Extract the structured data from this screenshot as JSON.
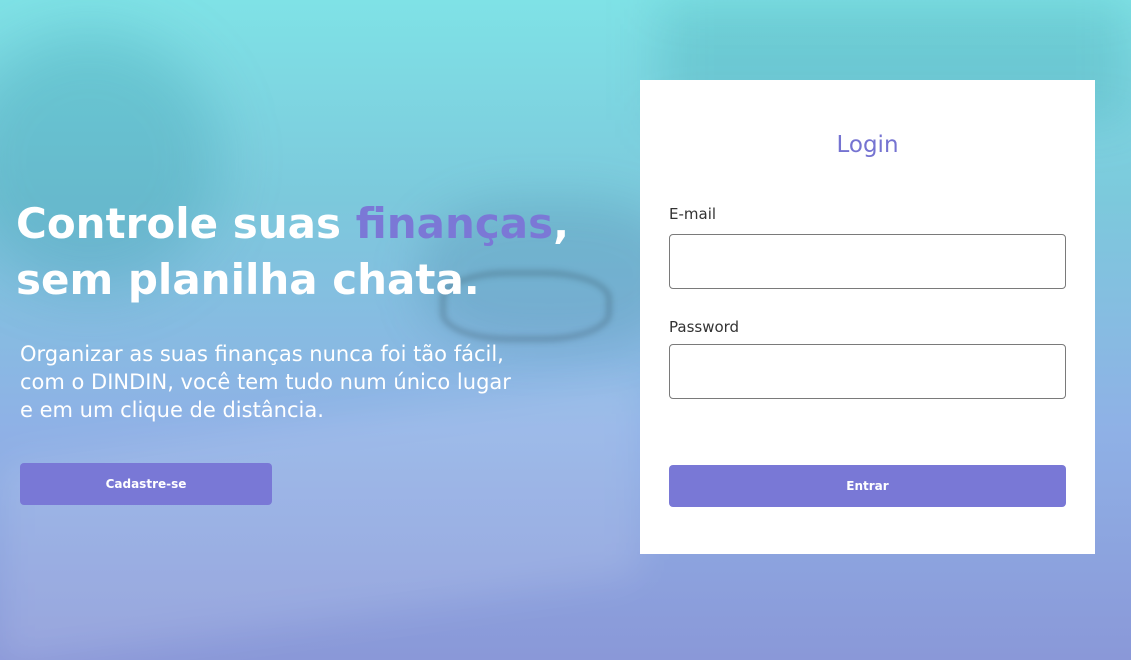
{
  "hero": {
    "headline_part1": "Controle suas ",
    "headline_accent": "finanças",
    "headline_part2": ",",
    "headline_line2": "sem planilha chata.",
    "subtitle_line1": "Organizar as suas finanças nunca foi tão fácil,",
    "subtitle_line2": "com o DINDIN, você tem tudo num único lugar",
    "subtitle_line3": "e em um clique de distância.",
    "signup_label": "Cadastre-se"
  },
  "login": {
    "title": "Login",
    "email_label": "E-mail",
    "email_value": "",
    "password_label": "Password",
    "password_value": "",
    "submit_label": "Entrar"
  },
  "colors": {
    "accent": "#7978d6",
    "title_accent": "#7573d1",
    "text_light": "#ffffff",
    "card_bg": "#ffffff"
  }
}
